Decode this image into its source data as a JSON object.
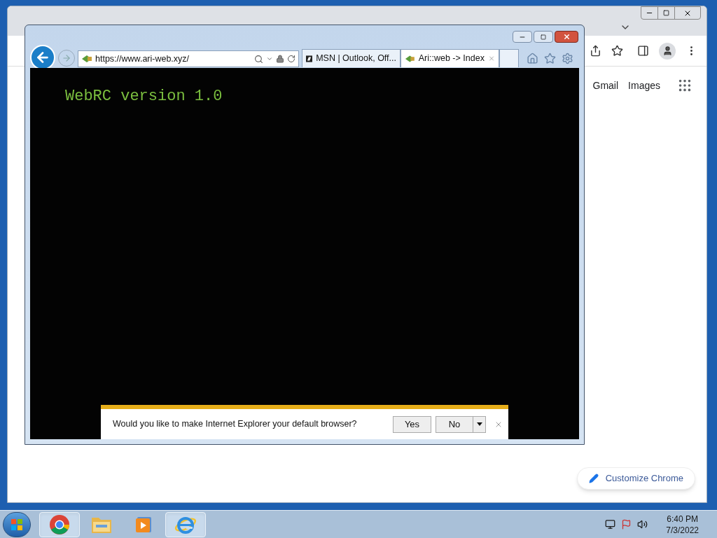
{
  "chrome_window": {
    "links": [
      "Gmail",
      "Images"
    ],
    "customize_button": "Customize Chrome"
  },
  "ie_window": {
    "address": "https://www.ari-web.xyz/",
    "tabs": [
      {
        "label": "MSN | Outlook, Off...",
        "selected": false
      },
      {
        "label": "Ari::web -> Index",
        "selected": true
      }
    ],
    "page_text": "WebRC version 1.0",
    "notification": {
      "message": "Would you like to make Internet Explorer your default browser?",
      "buttons": [
        "Yes",
        "No"
      ]
    }
  },
  "taskbar": {
    "apps": [
      {
        "kind": "chrome",
        "running": true
      },
      {
        "kind": "explorer",
        "running": false
      },
      {
        "kind": "media",
        "running": false
      },
      {
        "kind": "ie",
        "running": true
      }
    ],
    "time": "6:40 PM",
    "date": "7/3/2022"
  }
}
